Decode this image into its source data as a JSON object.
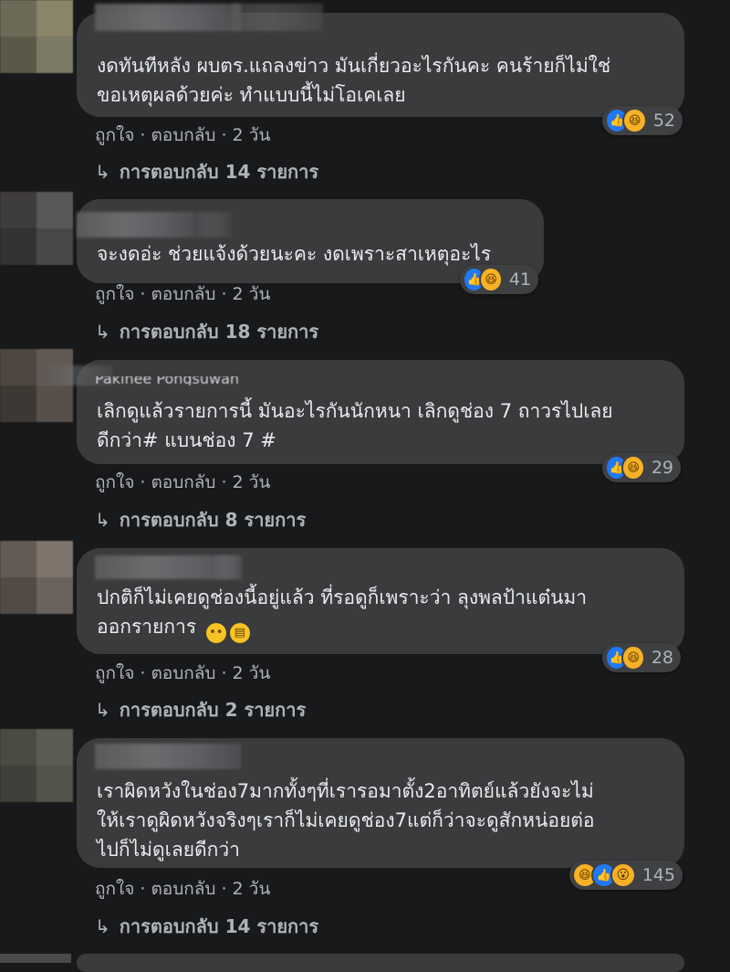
{
  "comments": [
    {
      "author_blurred": "",
      "text": "งดทันทีหลัง ผบตร.แถลงข่าว มันเกี่ยวอะไรกันคะ คนร้ายก็ไม่ใช่\nขอเหตุผลด้วยค่ะ ทำแบบนี้ไม่โอเคเลย",
      "reaction_count": "52",
      "reactions": [
        "like-icon",
        "haha-icon"
      ],
      "like_label": "ถูกใจ",
      "reply_label": "ตอบกลับ",
      "time": "2 วัน",
      "replies_text": "การตอบกลับ 14 รายการ"
    },
    {
      "author_blurred": "",
      "text": "จะงดอ่ะ ช่วยแจ้งด้วยนะคะ งดเพราะสาเหตุอะไร",
      "reaction_count": "41",
      "reactions": [
        "like-icon",
        "haha-icon"
      ],
      "like_label": "ถูกใจ",
      "reply_label": "ตอบกลับ",
      "time": "2 วัน",
      "replies_text": "การตอบกลับ 18 รายการ"
    },
    {
      "author_blurred": "Pakinee Pongsuwan",
      "text": "เลิกดูแล้วรายการนี้ มันอะไรกันนักหนา เลิกดูช่อง 7 ถาวรไปเลย\nดีกว่า# แบนช่อง 7 #",
      "reaction_count": "29",
      "reactions": [
        "like-icon",
        "haha-icon"
      ],
      "like_label": "ถูกใจ",
      "reply_label": "ตอบกลับ",
      "time": "2 วัน",
      "replies_text": "การตอบกลับ 8 รายการ"
    },
    {
      "author_blurred": "",
      "text_line1": "ปกติก็ไม่เคยดูช่องนี้อยู่แล้ว ที่รอดูก็เพราะว่า ลุงพลป้าแต๋นมา",
      "text_line2": "ออกรายการ",
      "reaction_count": "28",
      "reactions": [
        "like-icon",
        "haha-icon"
      ],
      "like_label": "ถูกใจ",
      "reply_label": "ตอบกลับ",
      "time": "2 วัน",
      "replies_text": "การตอบกลับ 2 รายการ"
    },
    {
      "author_blurred": "",
      "text": "เราผิดหวังในช่อง7มากทั้งๆที่เรารอมาตั้ง2อาทิตย์แล้วยังจะไม่\nให้เราดูผิดหวังจริงๆเราก็ไม่เคยดูช่อง7แต่ก็ว่าจะดูสักหน่อยต่อ\nไปก็ไม่ดูเลยดีกว่า",
      "reaction_count": "145",
      "reactions": [
        "haha-icon",
        "like-icon",
        "wow-icon"
      ],
      "like_label": "ถูกใจ",
      "reply_label": "ตอบกลับ",
      "time": "2 วัน",
      "replies_text": "การตอบกลับ 14 รายการ"
    }
  ],
  "separator": "·",
  "reply_arrow_icon": "reply-arrow-icon",
  "colors": {
    "background": "#18191a",
    "bubble": "#3a3b3c",
    "like": "#2078f4",
    "haha": "#f7b125",
    "secondary_text": "#b0b3b8"
  }
}
